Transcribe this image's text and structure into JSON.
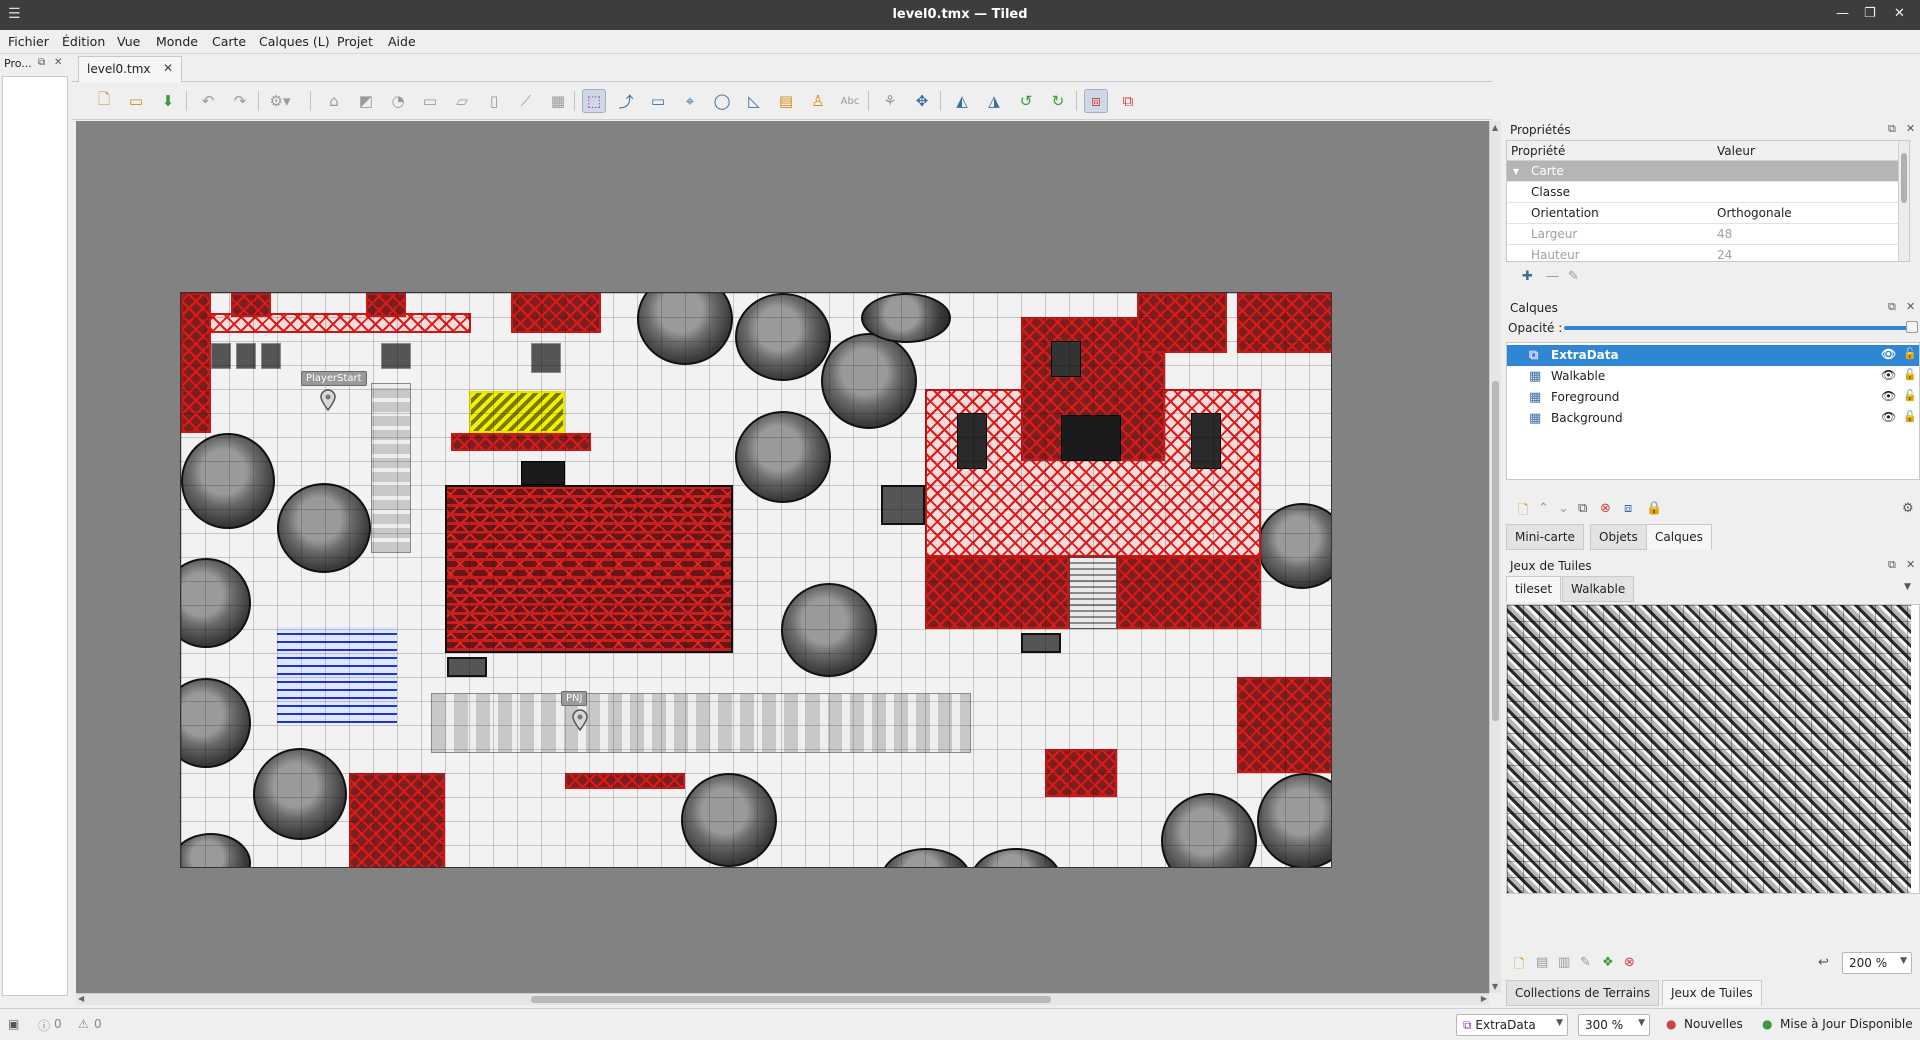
{
  "window": {
    "title": "level0.tmx — Tiled"
  },
  "menu": [
    "Fichier",
    "Édition",
    "Vue",
    "Monde",
    "Carte",
    "Calques (L)",
    "Projet",
    "Aide"
  ],
  "left_dock": {
    "title": "Pro..."
  },
  "document_tab": {
    "label": "level0.tmx"
  },
  "map_objects": {
    "player_start": "PlayerStart",
    "pnj": "PNJ"
  },
  "properties_panel": {
    "title": "Propriétés",
    "col_property": "Propriété",
    "col_value": "Valeur",
    "group": "Carte",
    "rows": [
      {
        "name": "Classe",
        "value": ""
      },
      {
        "name": "Orientation",
        "value": "Orthogonale"
      },
      {
        "name": "Largeur",
        "value": "48"
      },
      {
        "name": "Hauteur",
        "value": "24"
      }
    ]
  },
  "layers_panel": {
    "title": "Calques",
    "opacity_label": "Opacité :",
    "opacity": 1.0,
    "layers": [
      {
        "name": "ExtraData",
        "icon": "object-layer-icon",
        "selected": true
      },
      {
        "name": "Walkable",
        "icon": "tile-layer-icon",
        "selected": false
      },
      {
        "name": "Foreground",
        "icon": "tile-layer-icon",
        "selected": false
      },
      {
        "name": "Background",
        "icon": "tile-layer-icon",
        "selected": false
      }
    ],
    "tabs": [
      "Mini-carte",
      "Objets",
      "Calques"
    ],
    "active_tab": "Calques"
  },
  "tilesets_panel": {
    "title": "Jeux de Tuiles",
    "tabs": [
      "tileset",
      "Walkable"
    ],
    "active_tab": "tileset",
    "zoom": "200 %",
    "bottom_tabs": [
      "Collections de Terrains",
      "Jeux de Tuiles"
    ],
    "active_bottom_tab": "Jeux de Tuiles"
  },
  "statusbar": {
    "errors": "0",
    "warnings": "0",
    "layer_combo": "ExtraData",
    "zoom_combo": "300 %",
    "news": "Nouvelles",
    "update": "Mise à Jour Disponible"
  },
  "colors": {
    "selection": "#2e86d4",
    "collision": "#e01919",
    "canvas_bg": "#828282"
  }
}
